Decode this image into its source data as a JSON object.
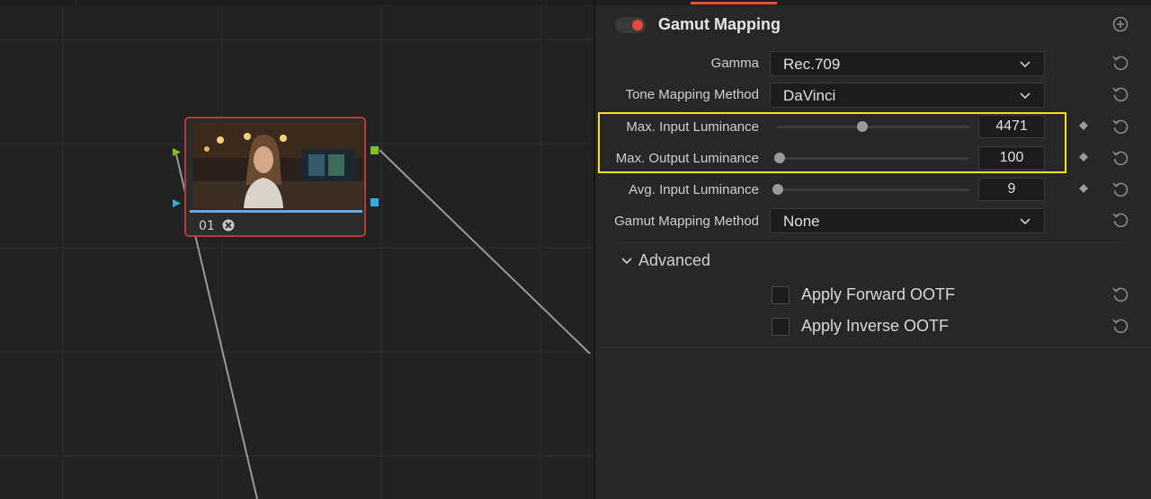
{
  "node_graph": {
    "node": {
      "label": "01"
    }
  },
  "inspector": {
    "section_title": "Gamut Mapping",
    "accent_color": "#e0513a",
    "rows": {
      "gamma": {
        "label": "Gamma",
        "value": "Rec.709"
      },
      "tone_mapping": {
        "label": "Tone Mapping Method",
        "value": "DaVinci"
      },
      "max_input": {
        "label": "Max. Input Luminance",
        "value": "4471"
      },
      "max_output": {
        "label": "Max. Output Luminance",
        "value": "100"
      },
      "avg_input": {
        "label": "Avg. Input Luminance",
        "value": "9"
      },
      "gamut_method": {
        "label": "Gamut Mapping Method",
        "value": "None"
      }
    },
    "advanced": {
      "label": "Advanced",
      "apply_forward": "Apply Forward OOTF",
      "apply_inverse": "Apply Inverse OOTF"
    },
    "highlight_color": "#f4e51e"
  }
}
